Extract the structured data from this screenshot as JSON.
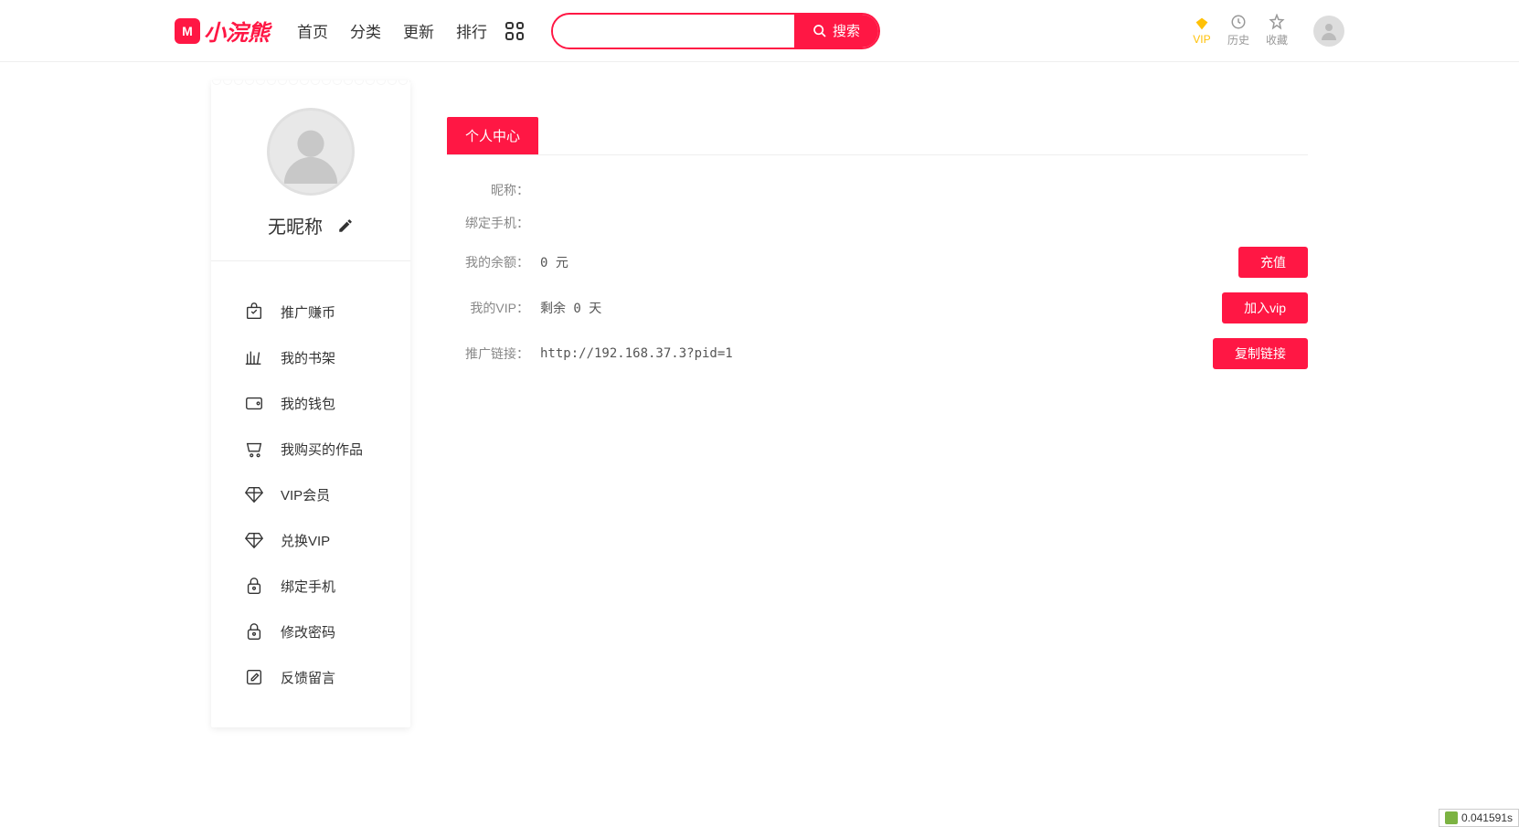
{
  "header": {
    "logo_text": "小浣熊",
    "nav": [
      "首页",
      "分类",
      "更新",
      "排行"
    ],
    "search_placeholder": "",
    "search_button": "搜索",
    "right": {
      "vip": "VIP",
      "history": "历史",
      "favorites": "收藏"
    }
  },
  "sidebar": {
    "nickname": "无昵称",
    "menu": [
      {
        "icon": "bag",
        "label": "推广赚币"
      },
      {
        "icon": "books",
        "label": "我的书架"
      },
      {
        "icon": "wallet",
        "label": "我的钱包"
      },
      {
        "icon": "cart",
        "label": "我购买的作品"
      },
      {
        "icon": "diamond",
        "label": "VIP会员"
      },
      {
        "icon": "diamond",
        "label": "兑换VIP"
      },
      {
        "icon": "lock",
        "label": "绑定手机"
      },
      {
        "icon": "lock",
        "label": "修改密码"
      },
      {
        "icon": "edit",
        "label": "反馈留言"
      }
    ]
  },
  "main": {
    "tab": "个人中心",
    "rows": [
      {
        "label": "昵称：",
        "value": "",
        "btn": null
      },
      {
        "label": "绑定手机：",
        "value": "",
        "btn": null
      },
      {
        "label": "我的余额：",
        "value": "0 元",
        "btn": "充值"
      },
      {
        "label": "我的VIP：",
        "value": "剩余 0 天",
        "btn": "加入vip"
      },
      {
        "label": "推广链接：",
        "value": "http://192.168.37.3?pid=1",
        "btn": "复制链接"
      }
    ]
  },
  "perf": "0.041591s"
}
